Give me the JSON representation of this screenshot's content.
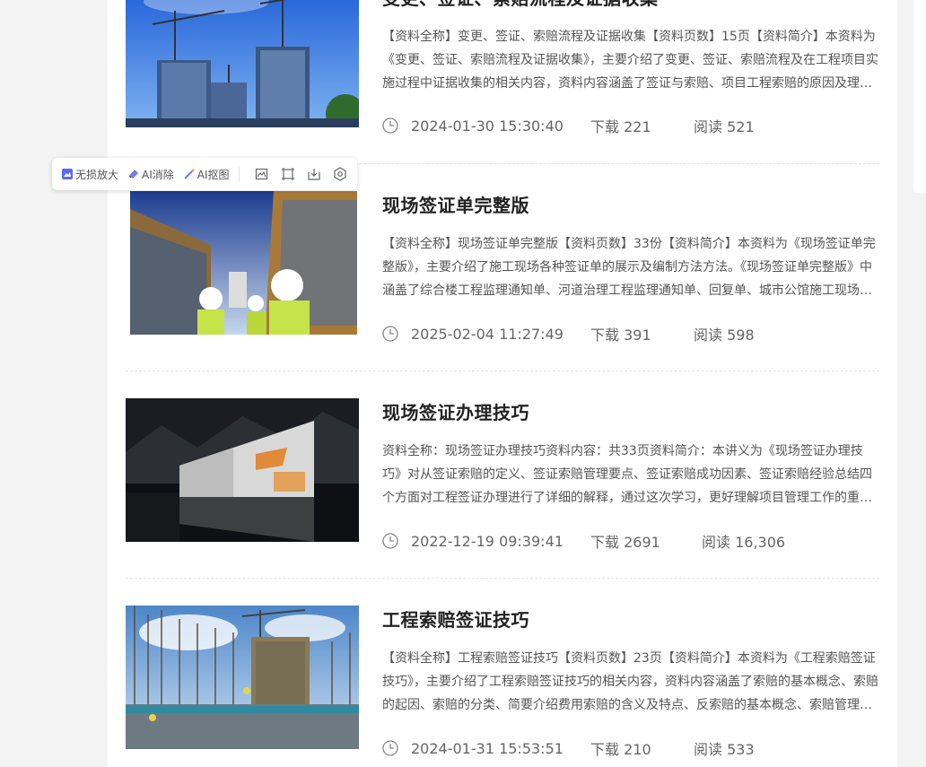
{
  "toolbar": {
    "lossless_zoom": "无损放大",
    "ai_erase": "AI消除",
    "ai_cutout": "AI抠图"
  },
  "items": [
    {
      "title": "变更、签证、索赔流程及证据收集",
      "desc": "【资料全称】变更、签证、索赔流程及证据收集【资料页数】15页【资料简介】本资料为《变更、签证、索赔流程及证据收集》，主要介绍了变更、签证、索赔流程及在工程项目实施过程中证据收集的相关内容，资料内容涵盖了签证与索赔、项目工程索赔的原因及理…",
      "date": "2024-01-30 15:30:40",
      "downloads": "下载 221",
      "reads": "阅读 521"
    },
    {
      "title": "现场签证单完整版",
      "desc": "【资料全称】现场签证单完整版【资料页数】33份【资料简介】本资料为《现场签证单完整版》，主要介绍了施工现场各种签证单的展示及编制方法方法。《现场签证单完整版》中涵盖了综合楼工程监理通知单、河道治理工程监理通知单、回复单、城市公馆施工现场…",
      "date": "2025-02-04 11:27:49",
      "downloads": "下载 391",
      "reads": "阅读 598"
    },
    {
      "title": "现场签证办理技巧",
      "desc": "资料全称：现场签证办理技巧资料内容：共33页资料简介：本讲义为《现场签证办理技巧》对从签证索赔的定义、签证索赔管理要点、签证索赔成功因素、签证索赔经验总结四个方面对工程签证办理进行了详细的解释，通过这次学习，更好理解项目管理工作的重…",
      "date": "2022-12-19 09:39:41",
      "downloads": "下载 2691",
      "reads": "阅读 16,306"
    },
    {
      "title": "工程索赔签证技巧",
      "desc": "【资料全称】工程索赔签证技巧【资料页数】23页【资料简介】本资料为《工程索赔签证技巧》，主要介绍了工程索赔签证技巧的相关内容，资料内容涵盖了索赔的基本概念、索赔的起因、索赔的分类、简要介绍费用索赔的含义及特点、反索赔的基本概念、索赔管理…",
      "date": "2024-01-31 15:53:51",
      "downloads": "下载 210",
      "reads": "阅读 533"
    }
  ]
}
